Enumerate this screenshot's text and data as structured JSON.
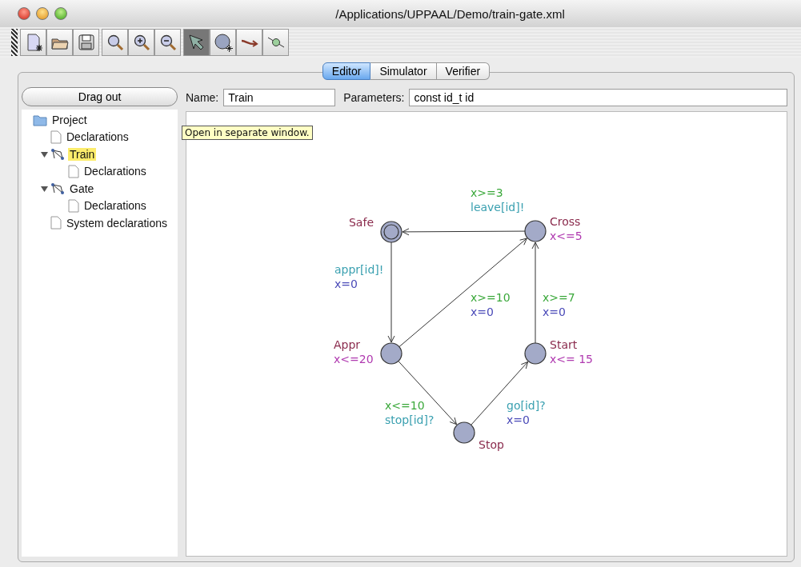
{
  "window": {
    "title": "/Applications/UPPAAL/Demo/train-gate.xml"
  },
  "toolbar": [
    {
      "kind": "new",
      "selected": false
    },
    {
      "kind": "open",
      "selected": false
    },
    {
      "kind": "save",
      "selected": false
    },
    {
      "kind": "zoom",
      "selected": false
    },
    {
      "kind": "zoomin",
      "selected": false
    },
    {
      "kind": "zoomout",
      "selected": false
    },
    {
      "kind": "select",
      "selected": true
    },
    {
      "kind": "location",
      "selected": false
    },
    {
      "kind": "edge",
      "selected": false
    },
    {
      "kind": "nail",
      "selected": false
    }
  ],
  "tabs": [
    {
      "label": "Editor",
      "selected": true
    },
    {
      "label": "Simulator",
      "selected": false
    },
    {
      "label": "Verifier",
      "selected": false
    }
  ],
  "drag_out_button": "Drag out",
  "tree": [
    {
      "label": "Project",
      "kind": "folder",
      "selected": false,
      "children": [
        {
          "label": "Declarations",
          "kind": "doc",
          "selected": false
        },
        {
          "label": "Train",
          "kind": "template",
          "expanded": true,
          "selected": true,
          "children": [
            {
              "label": "Declarations",
              "kind": "doc",
              "selected": false
            }
          ]
        },
        {
          "label": "Gate",
          "kind": "template",
          "expanded": true,
          "selected": false,
          "children": [
            {
              "label": "Declarations",
              "kind": "doc",
              "selected": false
            }
          ]
        },
        {
          "label": "System declarations",
          "kind": "doc",
          "selected": false
        }
      ]
    }
  ],
  "tooltip": "Open in separate window.",
  "name_field": {
    "label": "Name:",
    "value": "Train"
  },
  "parameters_field": {
    "label": "Parameters:",
    "value": "const id_t id"
  },
  "automaton": {
    "locations": [
      {
        "name": "Safe",
        "initial": true
      },
      {
        "name": "Cross",
        "invariant": "x<=5",
        "initial": false
      },
      {
        "name": "Appr",
        "invariant": "x<=20",
        "initial": false
      },
      {
        "name": "Start",
        "invariant": "x<= 15",
        "initial": false
      },
      {
        "name": "Stop",
        "initial": false
      }
    ],
    "edges": [
      {
        "guard": "x>=3",
        "sync": "leave[id]!"
      },
      {
        "sync": "appr[id]!",
        "update": "x=0"
      },
      {
        "guard": "x>=10",
        "update": "x=0"
      },
      {
        "guard": "x>=7",
        "update": "x=0"
      },
      {
        "guard": "x<=10",
        "sync": "stop[id]?"
      },
      {
        "sync": "go[id]?",
        "update": "x=0"
      }
    ]
  }
}
